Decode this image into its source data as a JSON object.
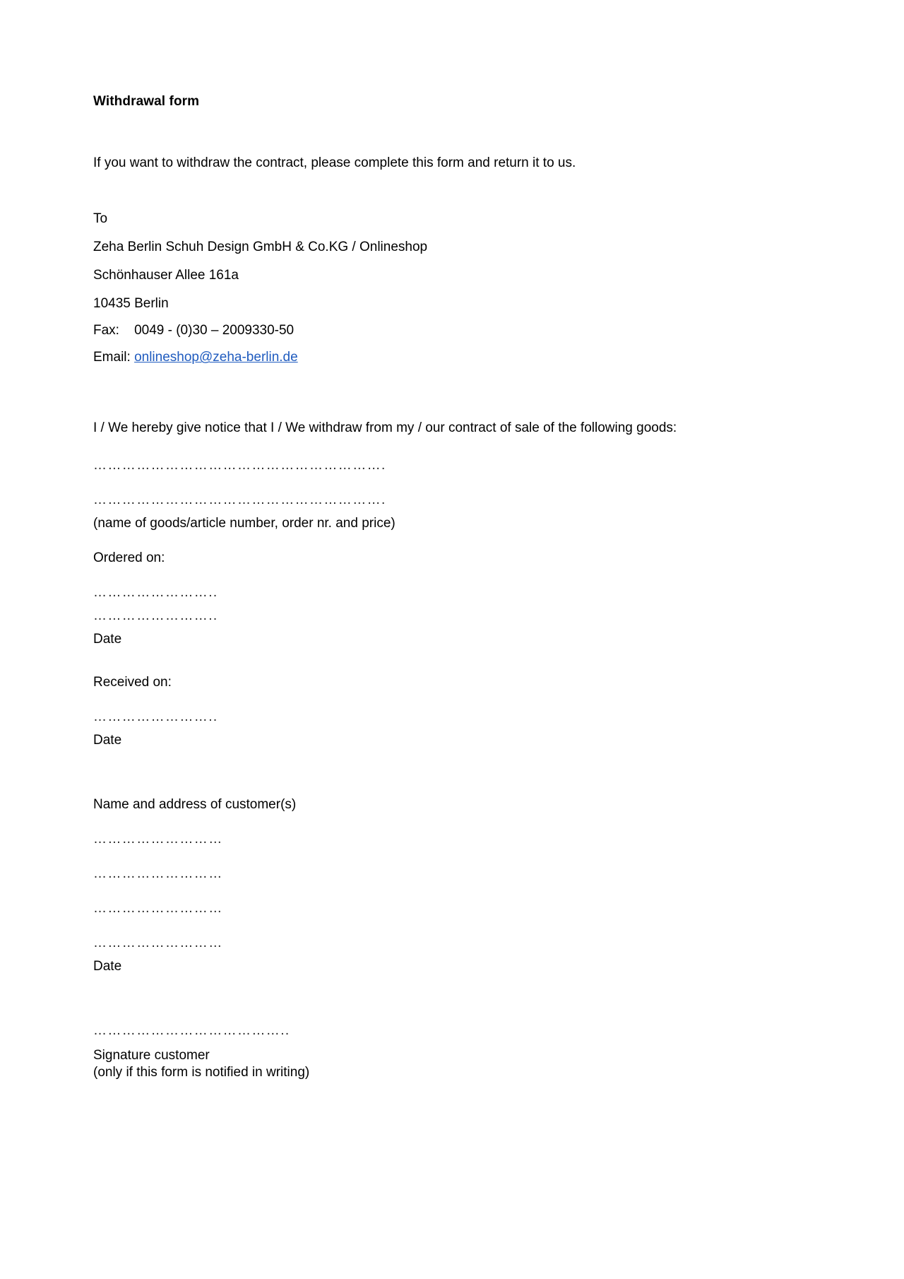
{
  "document": {
    "title": "Withdrawal form",
    "intro": "If you want to withdraw the contract, please complete this form and return it to us.",
    "recipient": {
      "to_label": "To",
      "company": "Zeha Berlin Schuh Design GmbH & Co.KG / Onlineshop",
      "street": "Schönhauser Allee 161a",
      "city": "10435 Berlin",
      "fax": "Fax:    0049 - (0)30 – 2009330-50",
      "email_label": "Email:",
      "email_address": "onlineshop@zeha-berlin.de",
      "email_link_color": "#1f5bbf"
    },
    "declaration": "I / We hereby give notice that I / We withdraw from my / our contract of sale of the following goods:",
    "goods": {
      "fill_line_1": "…………………………………………………….",
      "fill_line_2": "…………………………………………………….",
      "caption": "(name of goods/article number, order nr. and price)"
    },
    "ordered_on": {
      "label": "Ordered on:",
      "fill_line_1": "……………………..",
      "fill_line_2": "……………………..",
      "date_label": "Date"
    },
    "received_on": {
      "label": "Received on:",
      "fill_line_1": "……………………..",
      "date_label": "Date"
    },
    "customer": {
      "label": "Name and address of customer(s)",
      "fill_line_1": "………………………",
      "fill_line_2": "………………………",
      "fill_line_3": "………………………",
      "fill_line_4": "………………………",
      "date_label": "Date"
    },
    "signature": {
      "fill_line": "…………………………………..",
      "label": "Signature customer",
      "note": "(only if this form is notified in writing)"
    }
  }
}
